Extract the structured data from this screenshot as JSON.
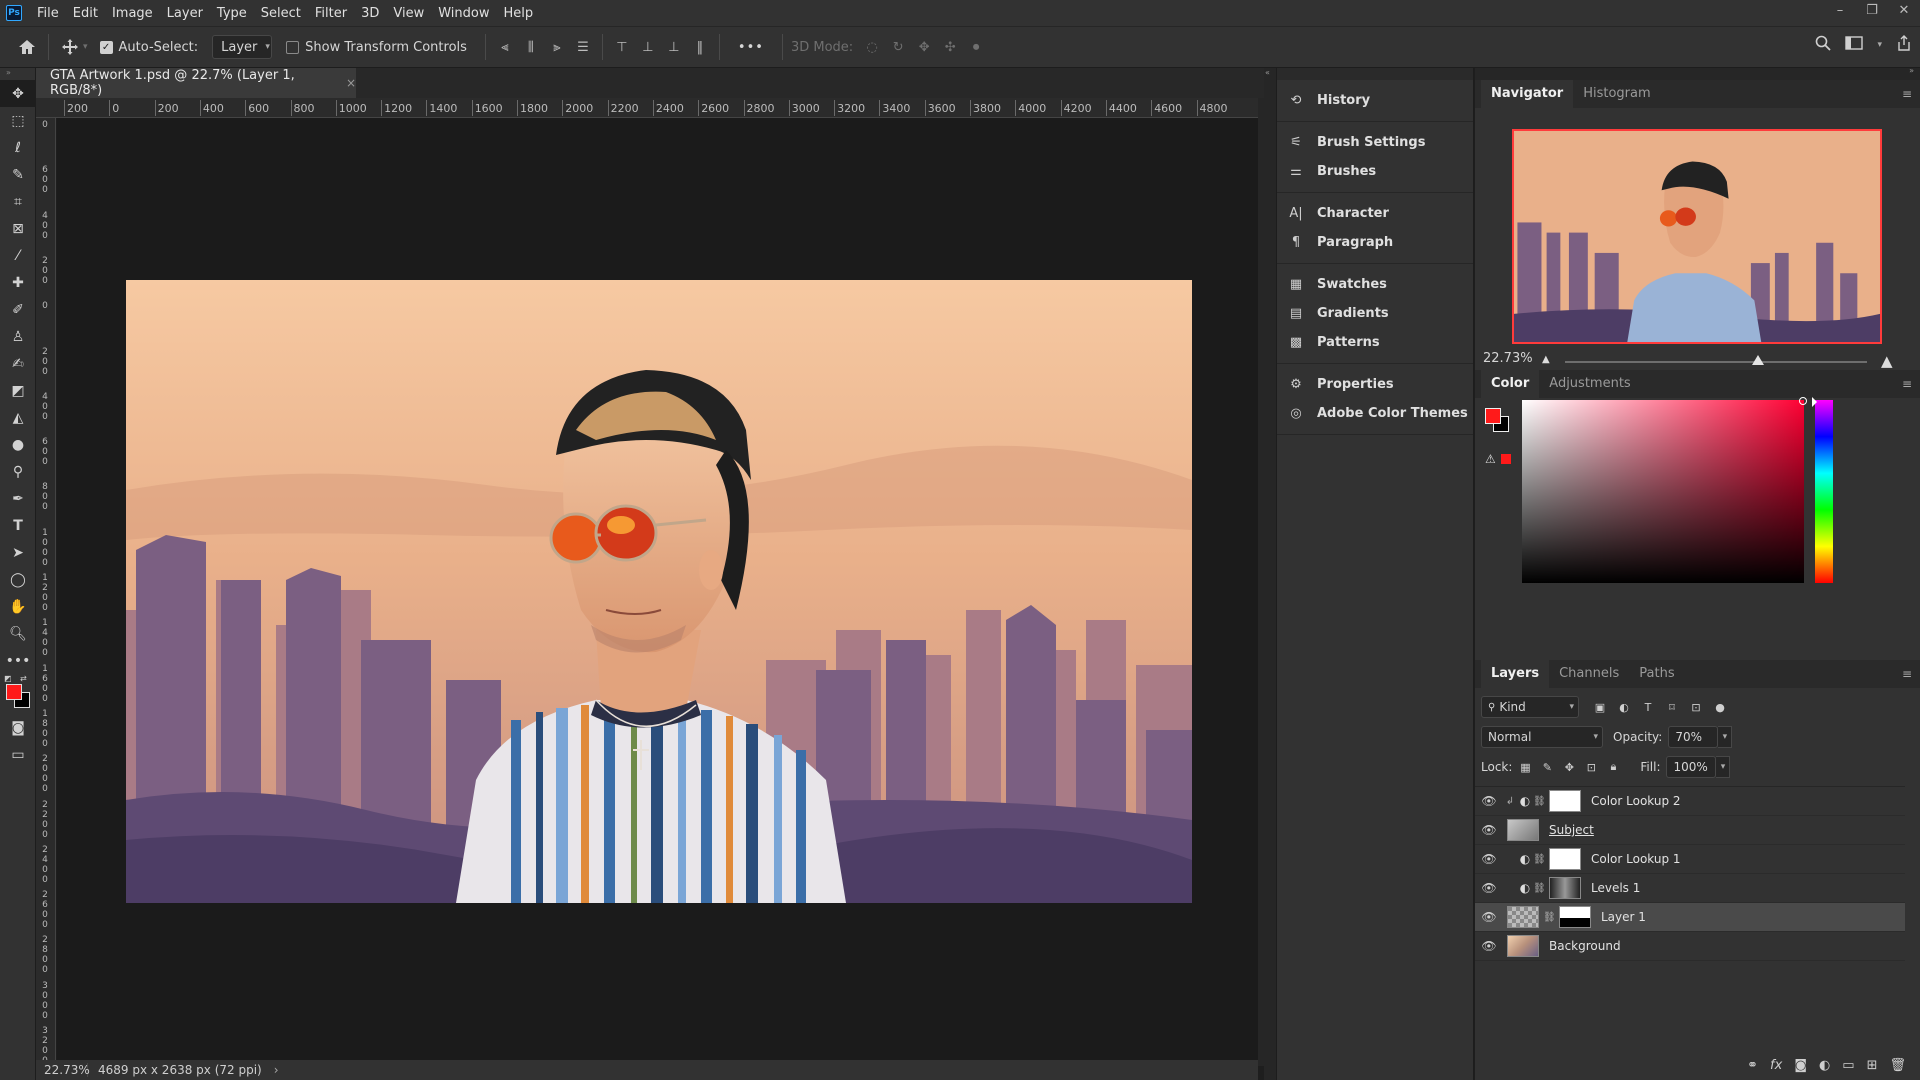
{
  "app": {
    "menu": [
      "File",
      "Edit",
      "Image",
      "Layer",
      "Type",
      "Select",
      "Filter",
      "3D",
      "View",
      "Window",
      "Help"
    ],
    "window_controls": [
      "–",
      "❐",
      "✕"
    ]
  },
  "options_bar": {
    "auto_select_label": "Auto-Select:",
    "auto_select_checked": true,
    "auto_select_target": "Layer",
    "show_transform_label": "Show Transform Controls",
    "more_label": "•••",
    "three_d_mode_label": "3D Mode:"
  },
  "document": {
    "tab_title": "GTA Artwork 1.psd @ 22.7% (Layer 1, RGB/8*)",
    "close_label": "×",
    "ruler_h_ticks": [
      "200",
      "0",
      "200",
      "400",
      "600",
      "800",
      "1000",
      "1200",
      "1400",
      "1600",
      "1800",
      "2000",
      "2200",
      "2400",
      "2600",
      "2800",
      "3000",
      "3200",
      "3400",
      "3600",
      "3800",
      "4000",
      "4200",
      "4400",
      "4600",
      "4800"
    ],
    "ruler_v_ticks": [
      "0",
      "6 0 0",
      "4 0 0",
      "2 0 0",
      "0",
      "2 0 0",
      "4 0 0",
      "6 0 0",
      "8 0 0",
      "1 0 0 0",
      "1 2 0 0",
      "1 4 0 0",
      "1 6 0 0",
      "1 8 0 0",
      "2 0 0 0",
      "2 2 0 0",
      "2 4 0 0",
      "2 6 0 0",
      "2 8 0 0",
      "3 0 0 0",
      "3 2 0 0"
    ]
  },
  "status": {
    "zoom": "22.73%",
    "doc_info": "4689 px x 2638 px (72 ppi)",
    "arrow": "›"
  },
  "collapsed_panels": {
    "groups": [
      [
        {
          "icon": "history-icon",
          "label": "History"
        }
      ],
      [
        {
          "icon": "brush-settings-icon",
          "label": "Brush Settings"
        },
        {
          "icon": "brushes-icon",
          "label": "Brushes"
        }
      ],
      [
        {
          "icon": "character-icon",
          "label": "Character"
        },
        {
          "icon": "paragraph-icon",
          "label": "Paragraph"
        }
      ],
      [
        {
          "icon": "swatches-icon",
          "label": "Swatches"
        },
        {
          "icon": "gradients-icon",
          "label": "Gradients"
        },
        {
          "icon": "patterns-icon",
          "label": "Patterns"
        }
      ],
      [
        {
          "icon": "properties-icon",
          "label": "Properties"
        },
        {
          "icon": "adobe-color-themes-icon",
          "label": "Adobe Color Themes"
        }
      ]
    ]
  },
  "navigator": {
    "tabs": [
      "Navigator",
      "Histogram"
    ],
    "zoom": "22.73%",
    "zoom_slider_fraction": 0.64
  },
  "color_panel": {
    "tabs": [
      "Color",
      "Adjustments"
    ],
    "foreground": "#ff1a1a",
    "background": "#000000"
  },
  "layers_panel": {
    "tabs": [
      "Layers",
      "Channels",
      "Paths"
    ],
    "kind_label": "Kind",
    "blend_mode": "Normal",
    "opacity_label": "Opacity:",
    "opacity": "70%",
    "lock_label": "Lock:",
    "fill_label": "Fill:",
    "fill": "100%",
    "layers": [
      {
        "name": "Color Lookup 2",
        "type": "adjustment",
        "clipped": true,
        "thumb": "white",
        "selected": false
      },
      {
        "name": "Subject",
        "type": "smart",
        "clipped": false,
        "thumb": "smart",
        "selected": false
      },
      {
        "name": "Color Lookup 1",
        "type": "adjustment",
        "clipped": false,
        "thumb": "white",
        "selected": false
      },
      {
        "name": "Levels 1",
        "type": "adjustment",
        "clipped": false,
        "thumb": "grad",
        "selected": false
      },
      {
        "name": "Layer 1",
        "type": "pixel",
        "clipped": false,
        "thumb": "mask",
        "selected": true
      },
      {
        "name": "Background",
        "type": "smart",
        "clipped": false,
        "thumb": "photo",
        "selected": false
      }
    ]
  },
  "colors": {
    "accent_red": "#ff1a1a",
    "panel_bg": "#323232",
    "canvas_bg": "#1b1b1b"
  }
}
